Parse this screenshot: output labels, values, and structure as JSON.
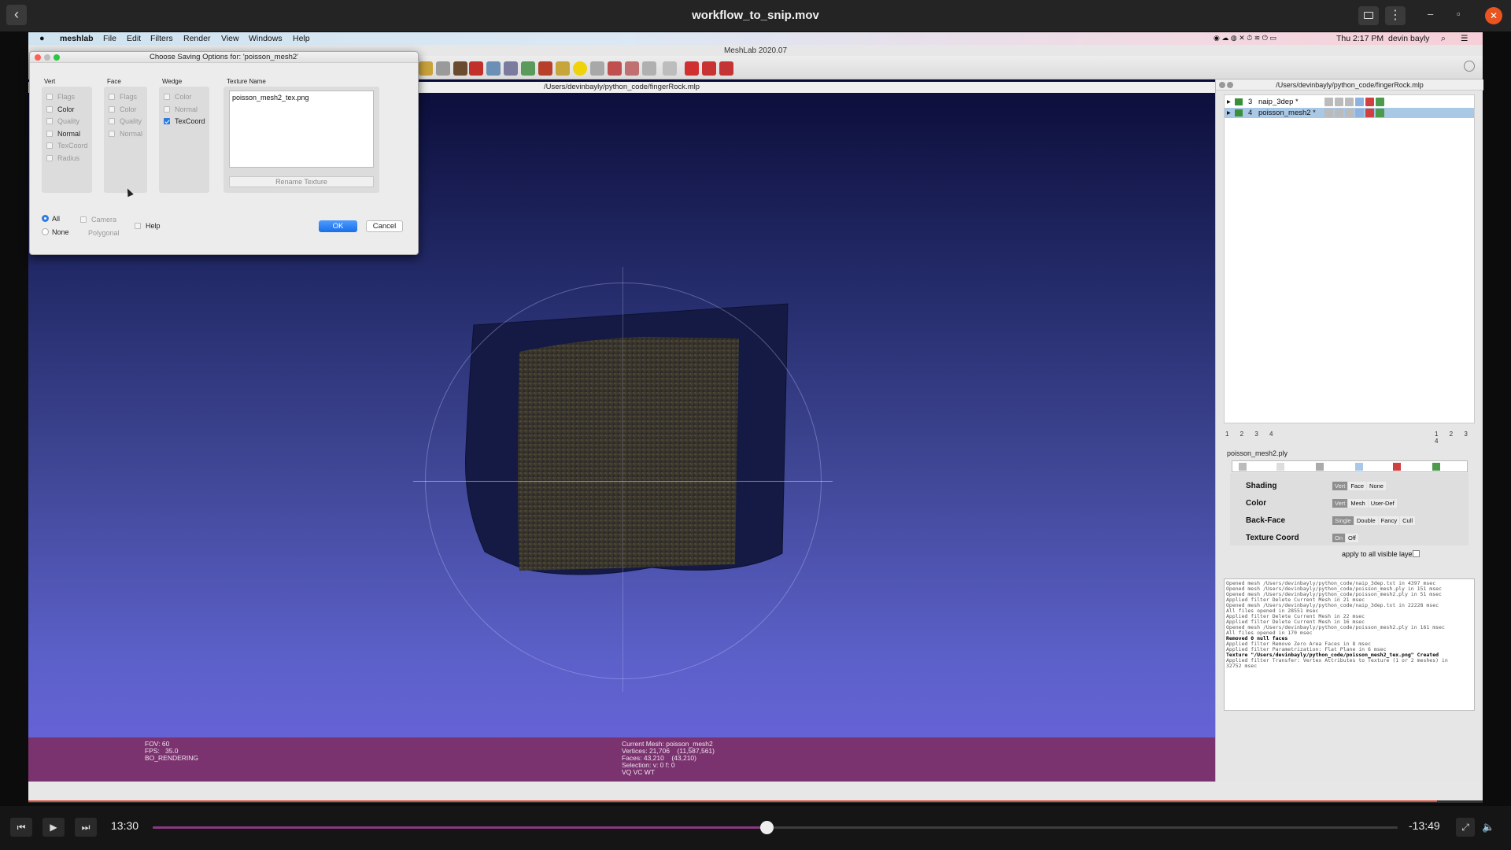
{
  "player": {
    "title": "workflow_to_snip.mov",
    "back_icon": "‹",
    "kebab_icon": "⋮",
    "minimize": "–",
    "maximize": "▫",
    "close": "✕",
    "current_time": "13:30",
    "remaining_time": "-13:49",
    "progress": 0.493
  },
  "menubar": {
    "app": "meshlab",
    "items": [
      "File",
      "Edit",
      "Filters",
      "Render",
      "View",
      "Windows",
      "Help"
    ],
    "clock": "Thu 2:17 PM",
    "user": "devin bayly"
  },
  "meshlab": {
    "window_title": "MeshLab 2020.07",
    "project_path": "/Users/devinbayly/python_code/fingerRock.mlp"
  },
  "viewport": {
    "stats_left": "FOV: 60\nFPS:   35.0\nBO_RENDERING",
    "stats_right": "Current Mesh: poisson_mesh2\nVertices: 21,706    (11,587,561)\nFaces: 43,210    (43,210)\nSelection: v: 0 f: 0\nVQ VC WT"
  },
  "layers": [
    {
      "num": "3",
      "name": "naip_3dep *"
    },
    {
      "num": "4",
      "name": "poisson_mesh2 *"
    }
  ],
  "pages_left": "1 2 3 4",
  "pages_right": "1 2 3 4",
  "decorator": {
    "mesh": "poisson_mesh2.ply",
    "shading_label": "Shading",
    "shading_opts": [
      "Vert",
      "Face",
      "None"
    ],
    "color_label": "Color",
    "color_opts": [
      "Vert",
      "Mesh",
      "User-Def"
    ],
    "backface_label": "Back-Face",
    "backface_opts": [
      "Single",
      "Double",
      "Fancy",
      "Cull"
    ],
    "texcoord_label": "Texture Coord",
    "texcoord_opts": [
      "On",
      "Off"
    ],
    "apply_all": "apply to all visible layers"
  },
  "log": [
    "Opened mesh /Users/devinbayly/python_code/naip_3dep.txt in 4397 msec",
    "Opened mesh /Users/devinbayly/python_code/poisson_mesh.ply in 151 msec",
    "Opened mesh /Users/devinbayly/python_code/poisson_mesh2.ply in 51 msec",
    "Applied filter Delete Current Mesh in 21 msec",
    "Opened mesh /Users/devinbayly/python_code/naip_3dep.txt in 22228 msec",
    "All files opened in 28551 msec",
    "Applied filter Delete Current Mesh in 22 msec",
    "Applied filter Delete Current Mesh in 16 msec",
    "Opened mesh /Users/devinbayly/python_code/poisson_mesh2.ply in 161 msec",
    "All files opened in 170 msec",
    "Removed 0 null faces",
    "Applied filter Remove Zero Area Faces in 8 msec",
    "Applied filter Parametrization: Flat Plane in 6 msec",
    "Texture \"/Users/devinbayly/python_code/poisson_mesh2_tex.png\" Created",
    "Applied filter Transfer: Vertex Attributes to Texture (1 or 2 meshes) in",
    "32752 msec"
  ],
  "dialog": {
    "title": "Choose Saving Options for: 'poisson_mesh2'",
    "vert_label": "Vert",
    "face_label": "Face",
    "wedge_label": "Wedge",
    "texname_label": "Texture Name",
    "vert_opts": [
      {
        "label": "Flags",
        "enabled": false,
        "checked": false
      },
      {
        "label": "Color",
        "enabled": true,
        "checked": false
      },
      {
        "label": "Quality",
        "enabled": false,
        "checked": false
      },
      {
        "label": "Normal",
        "enabled": true,
        "checked": false
      },
      {
        "label": "TexCoord",
        "enabled": false,
        "checked": false
      },
      {
        "label": "Radius",
        "enabled": false,
        "checked": false
      }
    ],
    "face_opts": [
      {
        "label": "Flags",
        "enabled": false,
        "checked": false
      },
      {
        "label": "Color",
        "enabled": false,
        "checked": false
      },
      {
        "label": "Quality",
        "enabled": false,
        "checked": false
      },
      {
        "label": "Normal",
        "enabled": false,
        "checked": false
      }
    ],
    "wedge_opts": [
      {
        "label": "Color",
        "enabled": false,
        "checked": false
      },
      {
        "label": "Normal",
        "enabled": false,
        "checked": false
      },
      {
        "label": "TexCoord",
        "enabled": true,
        "checked": true
      }
    ],
    "texture_name": "poisson_mesh2_tex.png",
    "rename_label": "Rename Texture",
    "all_label": "All",
    "none_label": "None",
    "camera_label": "Camera",
    "polygonal_label": "Polygonal",
    "help_label": "Help",
    "ok_label": "OK",
    "cancel_label": "Cancel"
  }
}
